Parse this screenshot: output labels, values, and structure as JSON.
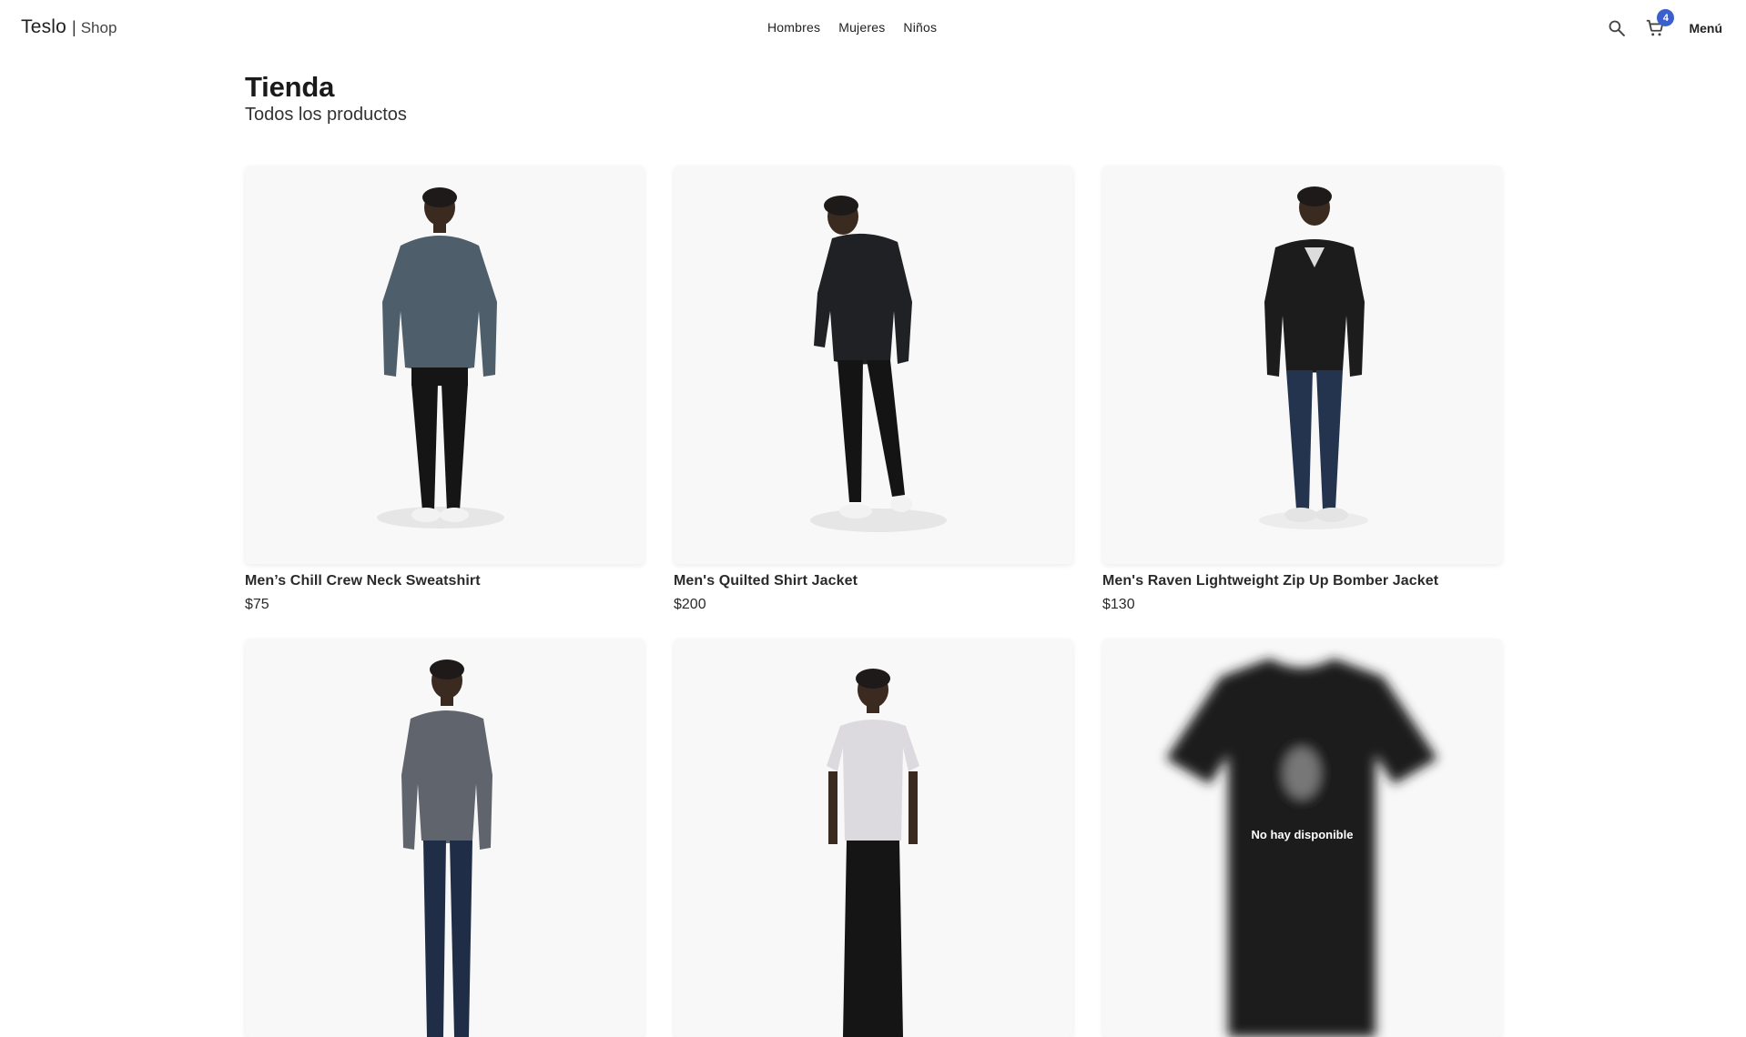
{
  "navbar": {
    "brand": "Teslo",
    "separator": "|",
    "brand_sub": "Shop",
    "links": [
      "Hombres",
      "Mujeres",
      "Niños"
    ],
    "cart_count": "4",
    "menu_label": "Menú",
    "badge_color": "#3b5fcc"
  },
  "header": {
    "title": "Tienda",
    "subtitle": "Todos los productos"
  },
  "products": [
    {
      "title": "Men’s Chill Crew Neck Sweatshirt",
      "price": "$75"
    },
    {
      "title": "Men's Quilted Shirt Jacket",
      "price": "$200"
    },
    {
      "title": "Men's Raven Lightweight Zip Up Bomber Jacket",
      "price": "$130"
    },
    {
      "title": "",
      "price": ""
    },
    {
      "title": "",
      "price": ""
    },
    {
      "title": "",
      "price": "",
      "overlay": "No hay disponible"
    }
  ]
}
